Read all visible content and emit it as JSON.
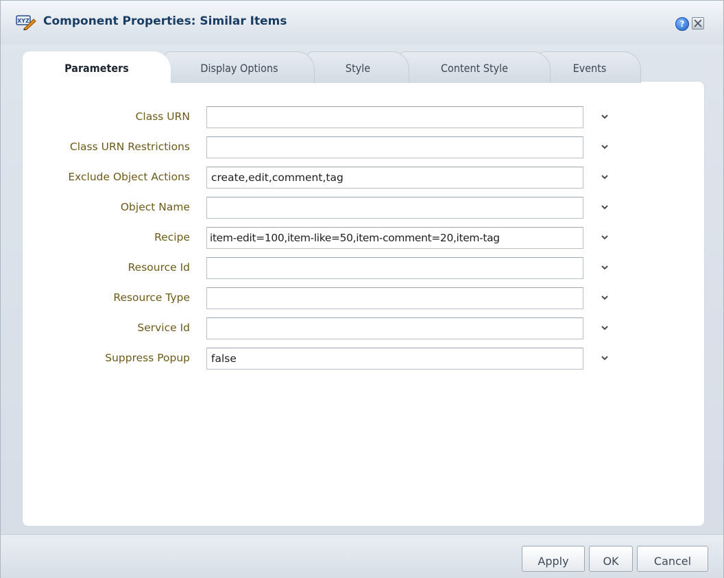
{
  "dialog": {
    "title": "Component Properties: Similar Items",
    "help_icon_glyph": "?"
  },
  "tabs": [
    {
      "label": "Parameters",
      "active": true
    },
    {
      "label": "Display Options",
      "active": false
    },
    {
      "label": "Style",
      "active": false
    },
    {
      "label": "Content Style",
      "active": false
    },
    {
      "label": "Events",
      "active": false
    }
  ],
  "fields": [
    {
      "label": "Class URN",
      "value": ""
    },
    {
      "label": "Class URN Restrictions",
      "value": ""
    },
    {
      "label": "Exclude Object Actions",
      "value": "create,edit,comment,tag"
    },
    {
      "label": "Object Name",
      "value": ""
    },
    {
      "label": "Recipe",
      "value": "item-edit=100,item-like=50,item-comment=20,item-tag"
    },
    {
      "label": "Resource Id",
      "value": ""
    },
    {
      "label": "Resource Type",
      "value": ""
    },
    {
      "label": "Service Id",
      "value": ""
    },
    {
      "label": "Suppress Popup",
      "value": "false"
    }
  ],
  "footer": {
    "apply_label": "Apply",
    "ok_label": "OK",
    "cancel_label": "Cancel"
  },
  "colors": {
    "title_text": "#1a3d63",
    "label_text": "#6b5a1a",
    "panel_bg": "#ffffff"
  },
  "icons": {
    "app": "component-xyz-icon",
    "help": "help-icon",
    "close": "close-icon",
    "field_dropdown": "chevron-down-icon"
  }
}
